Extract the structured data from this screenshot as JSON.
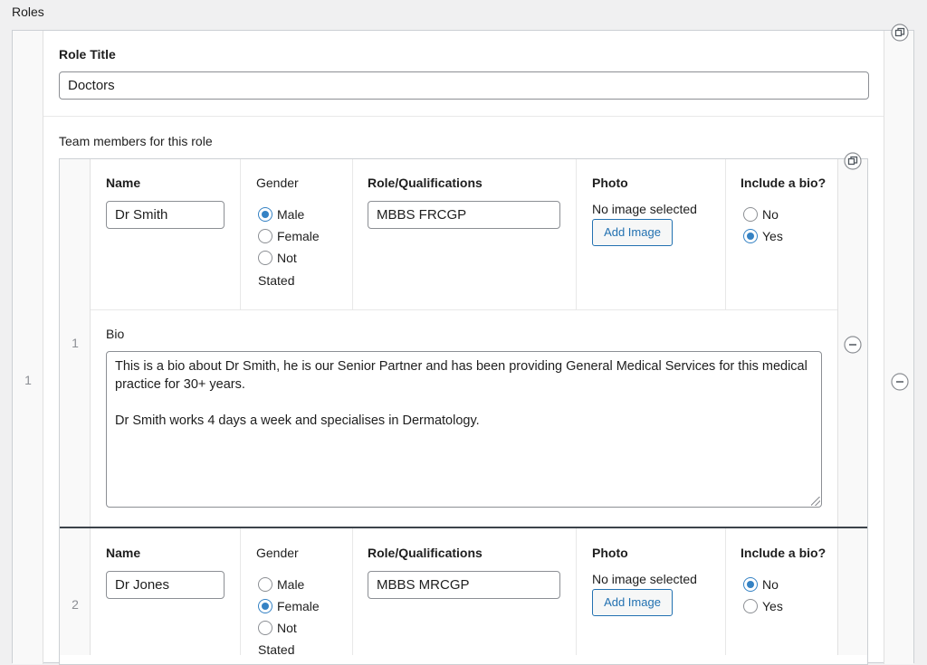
{
  "section": {
    "label": "Roles"
  },
  "outer_row": {
    "number": "1",
    "role_title_label": "Role Title",
    "role_title_value": "Doctors",
    "team_label": "Team members for this role"
  },
  "columns": {
    "name": "Name",
    "gender": "Gender",
    "role": "Role/Qualifications",
    "photo": "Photo",
    "include_bio": "Include a bio?"
  },
  "gender_options": {
    "male": "Male",
    "female": "Female",
    "not": "Not",
    "stated": "Stated"
  },
  "bio_options": {
    "no": "No",
    "yes": "Yes"
  },
  "photo": {
    "empty_text": "No image selected",
    "add_button": "Add Image"
  },
  "members": [
    {
      "number": "1",
      "name": "Dr Smith",
      "gender": "Male",
      "qualifications": "MBBS FRCGP",
      "include_bio": "Yes",
      "bio_label": "Bio",
      "bio_text": "This is a bio about Dr Smith, he is our Senior Partner and has been providing General Medical Services for this medical practice for 30+ years.\n\nDr Smith works 4 days a week and specialises in Dermatology."
    },
    {
      "number": "2",
      "name": "Dr Jones",
      "gender": "Female",
      "qualifications": "MBBS MRCGP",
      "include_bio": "No"
    }
  ],
  "colors": {
    "accent": "#3582c4",
    "button_blue": "#2271b1",
    "border": "#8c8f94"
  }
}
